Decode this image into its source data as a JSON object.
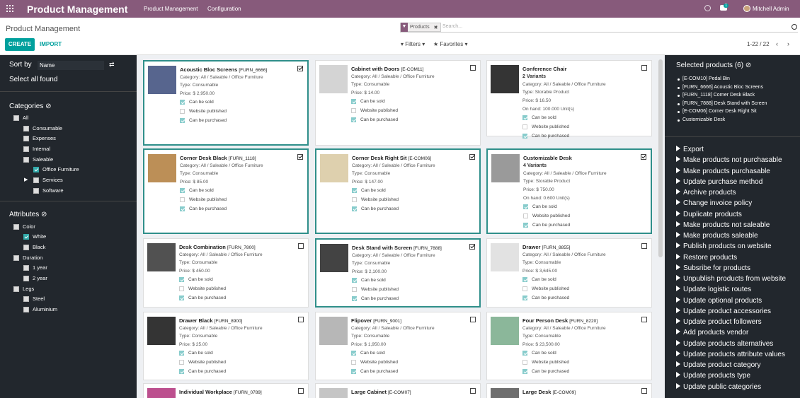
{
  "topbar": {
    "brand": "Product Management",
    "menu": [
      "Product Management",
      "Configuration"
    ],
    "chat_count": "1",
    "user": "Mitchell Admin"
  },
  "control": {
    "breadcrumb": "Product Management",
    "create": "CREATE",
    "import": "IMPORT",
    "facet": "Products",
    "search_placeholder": "Search...",
    "filters": "▾ Filters ▾",
    "favorites": "★ Favorites ▾",
    "pager": "1-22 / 22",
    "prev": "‹",
    "next": "›"
  },
  "left": {
    "sort_label": "Sort by",
    "sort_value": "Name",
    "select_all": "Select all found",
    "categories_title": "Categories ⊘",
    "attributes_title": "Attributes ⊘",
    "categories": [
      "All",
      "Consumable",
      "Expenses",
      "Internal",
      "Saleable",
      "Office Furniture",
      "Services",
      "Software"
    ],
    "attributes": [
      "Color",
      "White",
      "Black",
      "Duration",
      "1 year",
      "2 year",
      "Legs",
      "Steel",
      "Aluminium"
    ]
  },
  "products": [
    {
      "name": "Acoustic Bloc Screens",
      "ref": "[FURN_6666]",
      "category": "Category: All / Saleable / Office Furniture",
      "type": "Type: Consumable",
      "price": "Price: $ 2,950.00",
      "variants": "",
      "onhand": ""
    },
    {
      "name": "Cabinet with Doors",
      "ref": "[E-COM11]",
      "category": "Category: All / Saleable / Office Furniture",
      "type": "Type: Consumable",
      "price": "Price: $ 14.00",
      "variants": "",
      "onhand": ""
    },
    {
      "name": "Conference Chair",
      "ref": "",
      "category": "Category: All / Saleable / Office Furniture",
      "type": "Type: Storable Product",
      "price": "Price: $ 16.50",
      "variants": "2 Variants",
      "onhand": "On hand: 100.000 Unit(s)"
    },
    {
      "name": "Corner Desk Black",
      "ref": "[FURN_1118]",
      "category": "Category: All / Saleable / Office Furniture",
      "type": "Type: Consumable",
      "price": "Price: $ 85.00",
      "variants": "",
      "onhand": ""
    },
    {
      "name": "Corner Desk Right Sit",
      "ref": "[E-COM06]",
      "category": "Category: All / Saleable / Office Furniture",
      "type": "Type: Consumable",
      "price": "Price: $ 147.00",
      "variants": "",
      "onhand": ""
    },
    {
      "name": "Customizable Desk",
      "ref": "",
      "category": "Category: All / Saleable / Office Furniture",
      "type": "Type: Storable Product",
      "price": "Price: $ 750.00",
      "variants": "4 Variants",
      "onhand": "On hand: 0.600 Unit(s)"
    },
    {
      "name": "Desk Combination",
      "ref": "[FURN_7800]",
      "category": "Category: All / Saleable / Office Furniture",
      "type": "Type: Consumable",
      "price": "Price: $ 450.00",
      "variants": "",
      "onhand": ""
    },
    {
      "name": "Desk Stand with Screen",
      "ref": "[FURN_7888]",
      "category": "Category: All / Saleable / Office Furniture",
      "type": "Type: Consumable",
      "price": "Price: $ 2,100.00",
      "variants": "",
      "onhand": ""
    },
    {
      "name": "Drawer",
      "ref": "[FURN_8855]",
      "category": "Category: All / Saleable / Office Furniture",
      "type": "Type: Consumable",
      "price": "Price: $ 3,645.00",
      "variants": "",
      "onhand": ""
    },
    {
      "name": "Drawer Black",
      "ref": "[FURN_8900]",
      "category": "Category: All / Saleable / Office Furniture",
      "type": "Type: Consumable",
      "price": "Price: $ 25.00",
      "variants": "",
      "onhand": ""
    },
    {
      "name": "Flipover",
      "ref": "[FURN_9001]",
      "category": "Category: All / Saleable / Office Furniture",
      "type": "Type: Consumable",
      "price": "Price: $ 1,950.00",
      "variants": "",
      "onhand": ""
    },
    {
      "name": "Four Person Desk",
      "ref": "[FURN_8220]",
      "category": "Category: All / Saleable / Office Furniture",
      "type": "Type: Consumable",
      "price": "Price: $ 23,500.00",
      "variants": "",
      "onhand": ""
    },
    {
      "name": "Individual Workplace",
      "ref": "[FURN_0789]",
      "category": "",
      "type": "",
      "price": "",
      "variants": "",
      "onhand": ""
    },
    {
      "name": "Large Cabinet",
      "ref": "[E-COM07]",
      "category": "",
      "type": "",
      "price": "",
      "variants": "",
      "onhand": ""
    },
    {
      "name": "Large Desk",
      "ref": "[E-COM09]",
      "category": "",
      "type": "",
      "price": "",
      "variants": "",
      "onhand": ""
    }
  ],
  "flags": {
    "can_sold": "Can be sold",
    "website": "Website published",
    "can_purchased": "Can be purchased"
  },
  "right": {
    "selected_title": "Selected products (6) ⊘",
    "selected": [
      "[E-COM10] Pedal Bin",
      "[FURN_6666] Acoustic Bloc Screens",
      "[FURN_1118] Corner Desk Black",
      "[FURN_7888] Desk Stand with Screen",
      "[E-COM06] Corner Desk Right Sit",
      "Customizable Desk"
    ],
    "actions": [
      "Export",
      "Make products not purchasable",
      "Make products purchasable",
      "Update purchase method",
      "Archive products",
      "Change invoice policy",
      "Duplicate products",
      "Make products not saleable",
      "Make products saleable",
      "Publish products on website",
      "Restore products",
      "Subsribe for products",
      "Unpublish products from website",
      "Update logistic routes",
      "Update optional products",
      "Update product accessories",
      "Update product followers",
      "Add products vendor",
      "Update products alternatives",
      "Update products attribute values",
      "Update product category",
      "Update products type",
      "Update public categories"
    ]
  },
  "colors": {
    "topbar": "#875a7b",
    "accent": "#00a09d",
    "panel": "#22272d"
  }
}
